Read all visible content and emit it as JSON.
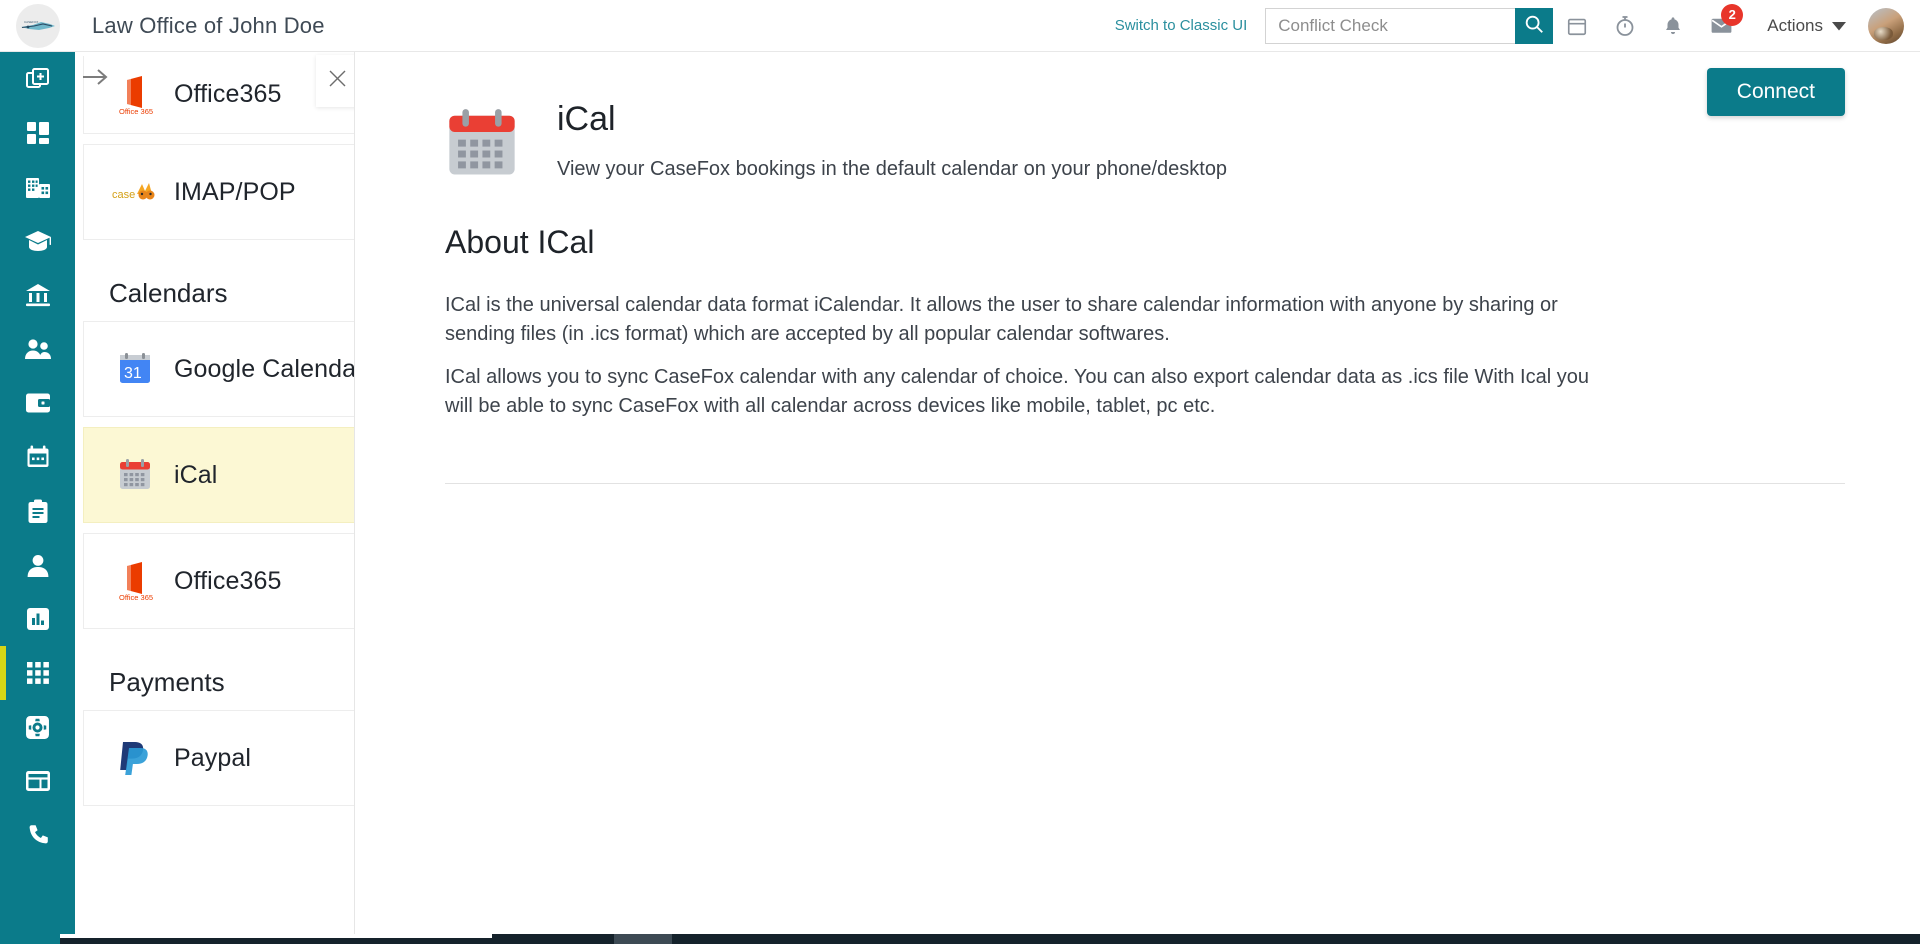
{
  "header": {
    "company_title": "Law Office of John Doe",
    "switch_ui_label": "Switch to Classic UI",
    "search_placeholder": "Conflict Check",
    "search_value": "",
    "search_icon": "search-icon",
    "calendar_icon": "calendar-icon",
    "timer_icon": "timer-icon",
    "bell_icon": "bell-icon",
    "notification_count": "2",
    "mail_icon": "mail-icon",
    "actions_label": "Actions",
    "actions_caret_icon": "chevron-down-icon",
    "avatar": "user-avatar",
    "brand_logo": "casefox-logo"
  },
  "rail": {
    "items": [
      {
        "icon": "add-document-icon",
        "name": "new-item",
        "active": false
      },
      {
        "icon": "dashboard-grid-icon",
        "name": "dashboard",
        "active": false
      },
      {
        "icon": "building-icon",
        "name": "companies",
        "active": false
      },
      {
        "icon": "graduation-cap-icon",
        "name": "matters",
        "active": false
      },
      {
        "icon": "bank-icon",
        "name": "accounts",
        "active": false
      },
      {
        "icon": "people-icon",
        "name": "contacts",
        "active": false
      },
      {
        "icon": "wallet-icon",
        "name": "billing",
        "active": false
      },
      {
        "icon": "calendar-icon",
        "name": "calendar",
        "active": false
      },
      {
        "icon": "clipboard-icon",
        "name": "tasks",
        "active": false
      },
      {
        "icon": "person-icon",
        "name": "clients",
        "active": false
      },
      {
        "icon": "bar-chart-icon",
        "name": "reports",
        "active": false
      },
      {
        "icon": "apps-grid-icon",
        "name": "integrations",
        "active": true
      },
      {
        "icon": "gear-icon",
        "name": "settings",
        "active": false
      },
      {
        "icon": "layout-icon",
        "name": "templates",
        "active": false
      },
      {
        "icon": "phone-icon",
        "name": "calls",
        "active": false
      }
    ]
  },
  "drawer": {
    "arrow_icon": "arrow-right-icon",
    "close_icon": "close-icon",
    "groups": [
      {
        "title": "",
        "items": [
          {
            "label": "Office365",
            "logo": "office365-logo",
            "selected": false
          },
          {
            "label": "IMAP/POP",
            "logo": "casefox-fox-logo",
            "selected": false
          }
        ]
      },
      {
        "title": "Calendars",
        "items": [
          {
            "label": "Google Calendar",
            "logo": "google-calendar-logo",
            "selected": false
          },
          {
            "label": "iCal",
            "logo": "ical-logo",
            "selected": true
          },
          {
            "label": "Office365",
            "logo": "office365-logo",
            "selected": false
          }
        ]
      },
      {
        "title": "Payments",
        "items": [
          {
            "label": "Paypal",
            "logo": "paypal-logo",
            "selected": false
          }
        ]
      }
    ]
  },
  "detail": {
    "icon": "ical-logo",
    "title": "iCal",
    "subtitle": "View your CaseFox bookings in the default calendar on your phone/desktop",
    "connect_label": "Connect",
    "about_heading": "About ICal",
    "paragraphs": [
      "ICal is the universal calendar data format iCalendar. It allows the user to share calendar information with anyone by sharing or sending files (in .ics format) which are accepted by all popular calendar softwares.",
      "ICal allows you to sync CaseFox calendar with any calendar of choice. You can also export calendar data as .ics file With Ical you will be able to sync CaseFox with all calendar across devices like mobile, tablet, pc etc."
    ]
  },
  "colors": {
    "brand_teal": "#0b7b8a",
    "accent_yellow": "#d6d617",
    "badge_red": "#e8352a",
    "selected_row": "#fcf8d4",
    "link_teal": "#2a8f9e"
  }
}
